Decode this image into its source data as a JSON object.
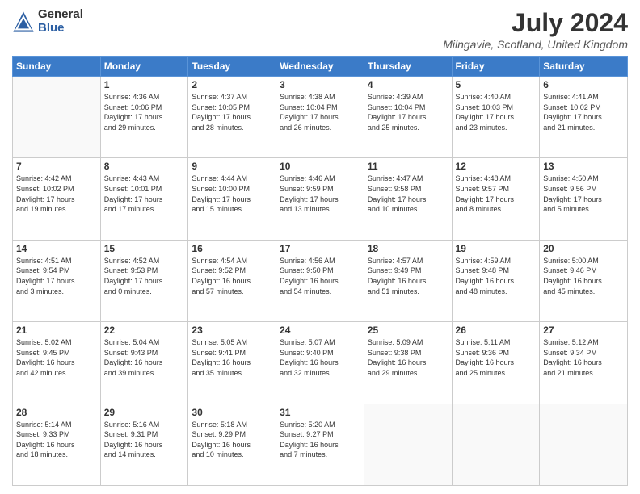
{
  "header": {
    "logo": {
      "general": "General",
      "blue": "Blue"
    },
    "title": "July 2024",
    "location": "Milngavie, Scotland, United Kingdom"
  },
  "calendar": {
    "days_of_week": [
      "Sunday",
      "Monday",
      "Tuesday",
      "Wednesday",
      "Thursday",
      "Friday",
      "Saturday"
    ],
    "weeks": [
      [
        {
          "day": "",
          "info": ""
        },
        {
          "day": "1",
          "info": "Sunrise: 4:36 AM\nSunset: 10:06 PM\nDaylight: 17 hours\nand 29 minutes."
        },
        {
          "day": "2",
          "info": "Sunrise: 4:37 AM\nSunset: 10:05 PM\nDaylight: 17 hours\nand 28 minutes."
        },
        {
          "day": "3",
          "info": "Sunrise: 4:38 AM\nSunset: 10:04 PM\nDaylight: 17 hours\nand 26 minutes."
        },
        {
          "day": "4",
          "info": "Sunrise: 4:39 AM\nSunset: 10:04 PM\nDaylight: 17 hours\nand 25 minutes."
        },
        {
          "day": "5",
          "info": "Sunrise: 4:40 AM\nSunset: 10:03 PM\nDaylight: 17 hours\nand 23 minutes."
        },
        {
          "day": "6",
          "info": "Sunrise: 4:41 AM\nSunset: 10:02 PM\nDaylight: 17 hours\nand 21 minutes."
        }
      ],
      [
        {
          "day": "7",
          "info": "Sunrise: 4:42 AM\nSunset: 10:02 PM\nDaylight: 17 hours\nand 19 minutes."
        },
        {
          "day": "8",
          "info": "Sunrise: 4:43 AM\nSunset: 10:01 PM\nDaylight: 17 hours\nand 17 minutes."
        },
        {
          "day": "9",
          "info": "Sunrise: 4:44 AM\nSunset: 10:00 PM\nDaylight: 17 hours\nand 15 minutes."
        },
        {
          "day": "10",
          "info": "Sunrise: 4:46 AM\nSunset: 9:59 PM\nDaylight: 17 hours\nand 13 minutes."
        },
        {
          "day": "11",
          "info": "Sunrise: 4:47 AM\nSunset: 9:58 PM\nDaylight: 17 hours\nand 10 minutes."
        },
        {
          "day": "12",
          "info": "Sunrise: 4:48 AM\nSunset: 9:57 PM\nDaylight: 17 hours\nand 8 minutes."
        },
        {
          "day": "13",
          "info": "Sunrise: 4:50 AM\nSunset: 9:56 PM\nDaylight: 17 hours\nand 5 minutes."
        }
      ],
      [
        {
          "day": "14",
          "info": "Sunrise: 4:51 AM\nSunset: 9:54 PM\nDaylight: 17 hours\nand 3 minutes."
        },
        {
          "day": "15",
          "info": "Sunrise: 4:52 AM\nSunset: 9:53 PM\nDaylight: 17 hours\nand 0 minutes."
        },
        {
          "day": "16",
          "info": "Sunrise: 4:54 AM\nSunset: 9:52 PM\nDaylight: 16 hours\nand 57 minutes."
        },
        {
          "day": "17",
          "info": "Sunrise: 4:56 AM\nSunset: 9:50 PM\nDaylight: 16 hours\nand 54 minutes."
        },
        {
          "day": "18",
          "info": "Sunrise: 4:57 AM\nSunset: 9:49 PM\nDaylight: 16 hours\nand 51 minutes."
        },
        {
          "day": "19",
          "info": "Sunrise: 4:59 AM\nSunset: 9:48 PM\nDaylight: 16 hours\nand 48 minutes."
        },
        {
          "day": "20",
          "info": "Sunrise: 5:00 AM\nSunset: 9:46 PM\nDaylight: 16 hours\nand 45 minutes."
        }
      ],
      [
        {
          "day": "21",
          "info": "Sunrise: 5:02 AM\nSunset: 9:45 PM\nDaylight: 16 hours\nand 42 minutes."
        },
        {
          "day": "22",
          "info": "Sunrise: 5:04 AM\nSunset: 9:43 PM\nDaylight: 16 hours\nand 39 minutes."
        },
        {
          "day": "23",
          "info": "Sunrise: 5:05 AM\nSunset: 9:41 PM\nDaylight: 16 hours\nand 35 minutes."
        },
        {
          "day": "24",
          "info": "Sunrise: 5:07 AM\nSunset: 9:40 PM\nDaylight: 16 hours\nand 32 minutes."
        },
        {
          "day": "25",
          "info": "Sunrise: 5:09 AM\nSunset: 9:38 PM\nDaylight: 16 hours\nand 29 minutes."
        },
        {
          "day": "26",
          "info": "Sunrise: 5:11 AM\nSunset: 9:36 PM\nDaylight: 16 hours\nand 25 minutes."
        },
        {
          "day": "27",
          "info": "Sunrise: 5:12 AM\nSunset: 9:34 PM\nDaylight: 16 hours\nand 21 minutes."
        }
      ],
      [
        {
          "day": "28",
          "info": "Sunrise: 5:14 AM\nSunset: 9:33 PM\nDaylight: 16 hours\nand 18 minutes."
        },
        {
          "day": "29",
          "info": "Sunrise: 5:16 AM\nSunset: 9:31 PM\nDaylight: 16 hours\nand 14 minutes."
        },
        {
          "day": "30",
          "info": "Sunrise: 5:18 AM\nSunset: 9:29 PM\nDaylight: 16 hours\nand 10 minutes."
        },
        {
          "day": "31",
          "info": "Sunrise: 5:20 AM\nSunset: 9:27 PM\nDaylight: 16 hours\nand 7 minutes."
        },
        {
          "day": "",
          "info": ""
        },
        {
          "day": "",
          "info": ""
        },
        {
          "day": "",
          "info": ""
        }
      ]
    ]
  }
}
